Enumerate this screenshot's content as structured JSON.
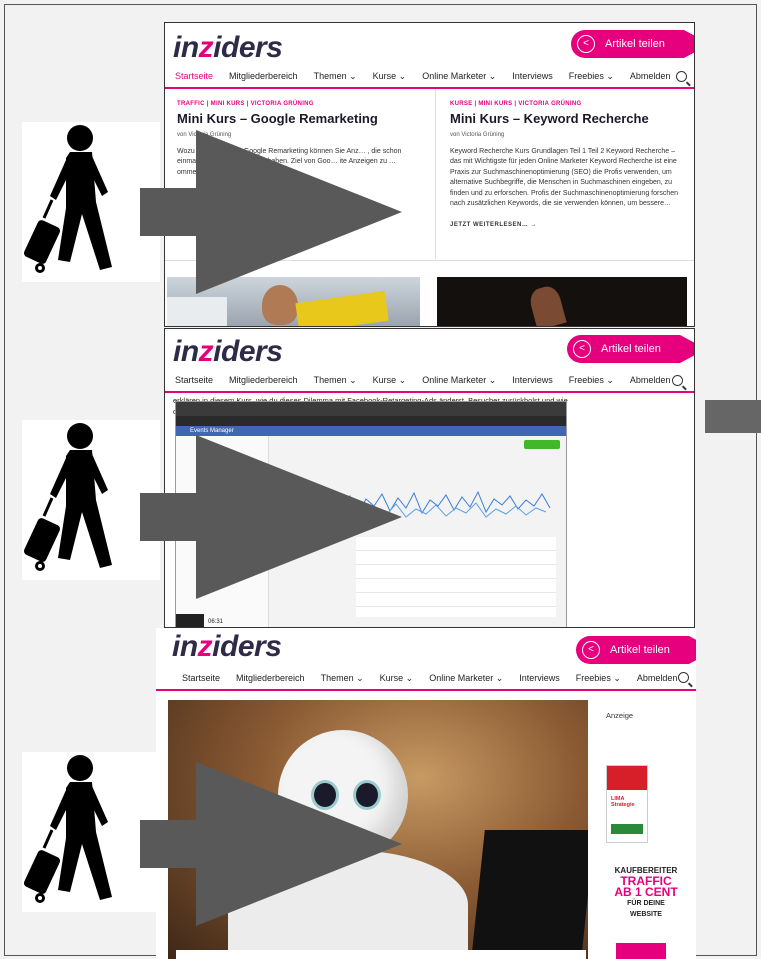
{
  "brand": {
    "logo_prefix": "in",
    "logo_z": "z",
    "logo_suffix": "iders",
    "share_label": "Artikel teilen",
    "accent": "#e6007e",
    "dark": "#2f2a47"
  },
  "nav1": [
    "Startseite",
    "Mitgliederbereich",
    "Themen ⌄",
    "Kurse ⌄",
    "Online Marketer ⌄",
    "Interviews",
    "Freebies ⌄",
    "Abmelden"
  ],
  "nav2": [
    "Startseite",
    "Mitgliederbereich",
    "Themen ⌄",
    "Kurse ⌄",
    "Online Marketer ⌄",
    "Interviews",
    "Freebies ⌄",
    "Abmelden"
  ],
  "nav3": [
    "Startseite",
    "Mitgliederbereich",
    "Themen ⌄",
    "Kurse ⌄",
    "Online Marketer ⌄",
    "Interviews",
    "Freebies ⌄",
    "Abmelden"
  ],
  "card_left": {
    "category": "TRAFFIC | MINI KURS | VICTORIA GRÜNING",
    "title": "Mini Kurs – Google Remarketing",
    "byline": "von Victoria Grüning",
    "excerpt": "Wozu … rketing? Mit Google Remarketing können Sie Anz… , die schon einmal auf ihrer Web… kauft haben. Ziel von Goo… ite Anzeigen zu …ommen",
    "more": "JETZ…"
  },
  "card_right": {
    "category": "KURSE | MINI KURS | VICTORIA GRÜNING",
    "title": "Mini Kurs – Keyword Recherche",
    "byline": "von Victoria Grüning",
    "excerpt": "Keyword Recherche Kurs Grundlagen Teil 1 Teil 2 Keyword Recherche – das mit Wichtigste für jeden Online Marketer Keyword Recherche ist eine Praxis zur Suchmaschinenoptimierung (SEO) die Profis verwenden, um alternative Suchbegriffe, die Menschen in Suchmaschinen eingeben, zu finden und zu erforschen. Profis der Suchmaschinenoptimierung forschen nach zusätzlichen Keywords, die sie verwenden können, um bessere…",
    "more": "JETZT WEITERLESEN… →"
  },
  "shot2_text": "erklären in diesem Kurs, wie du dieses Dilemma mit Facebook-Retargeting-Ads änderst, Besucher zurückholst und wie du deine erste Kampagne im Facebook Ads Manager anlegst.",
  "video": {
    "sidebar_title": "Events Manager",
    "time": "06:31"
  },
  "ad": {
    "label": "Anzeige",
    "line1": "KAUFBEREITER",
    "line2": "TRAFFIC",
    "line3": "AB 1 CENT",
    "line4": "FÜR DEINE",
    "line5": "WEBSITE",
    "book": "LIMA Strategie"
  }
}
